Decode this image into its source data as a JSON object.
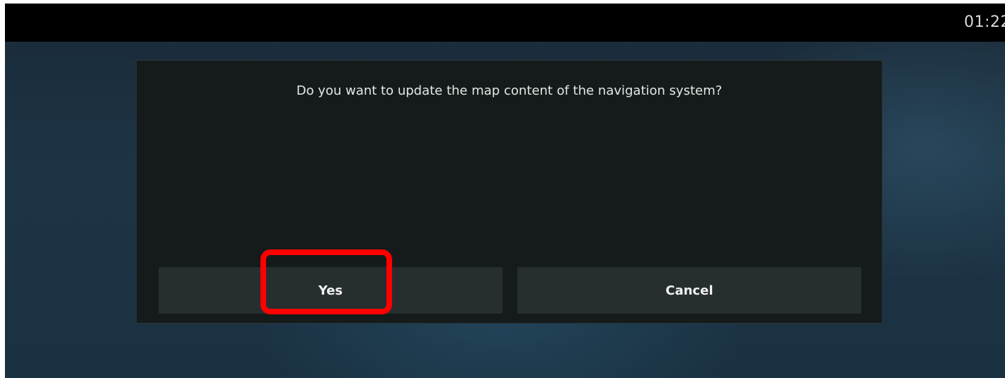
{
  "status_bar": {
    "time": "01:22"
  },
  "dialog": {
    "message": "Do you want to update the map content of the navigation system?",
    "yes_label": "Yes",
    "cancel_label": "Cancel"
  },
  "colors": {
    "highlight": "#ff0000",
    "dialog_bg": "#151b1b",
    "button_bg": "#272e2f"
  }
}
